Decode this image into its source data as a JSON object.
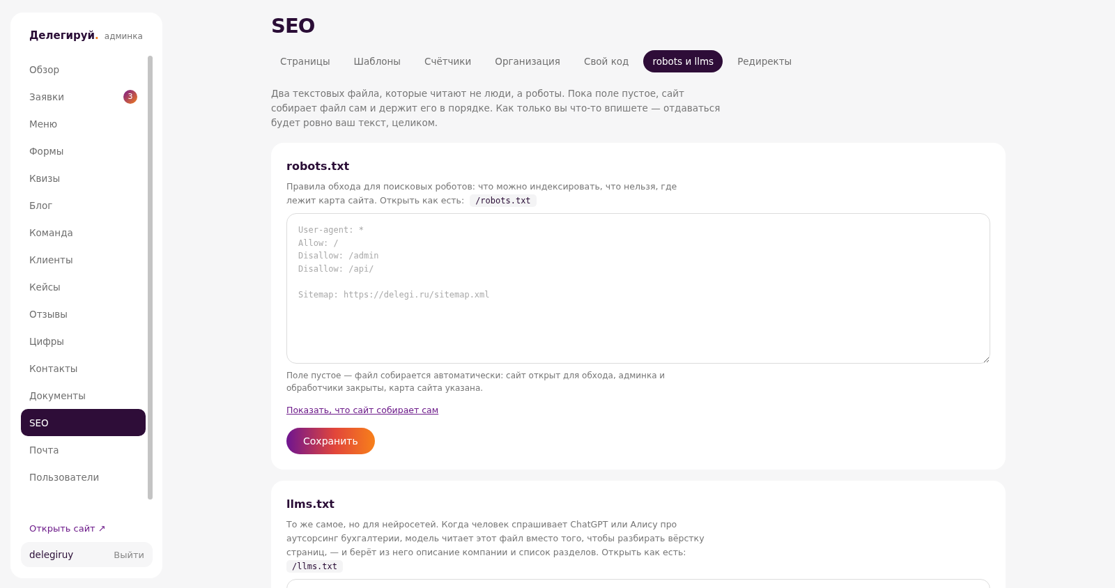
{
  "sidebar": {
    "brand": "Делегируй",
    "brand_dot": ".",
    "brand_sub": "админка",
    "items": [
      {
        "label": "Обзор",
        "selected": false
      },
      {
        "label": "Заявки",
        "selected": false,
        "badge": "3"
      },
      {
        "label": "Меню",
        "selected": false
      },
      {
        "label": "Формы",
        "selected": false
      },
      {
        "label": "Квизы",
        "selected": false
      },
      {
        "label": "Блог",
        "selected": false
      },
      {
        "label": "Команда",
        "selected": false
      },
      {
        "label": "Клиенты",
        "selected": false
      },
      {
        "label": "Кейсы",
        "selected": false
      },
      {
        "label": "Отзывы",
        "selected": false
      },
      {
        "label": "Цифры",
        "selected": false
      },
      {
        "label": "Контакты",
        "selected": false
      },
      {
        "label": "Документы",
        "selected": false
      },
      {
        "label": "SEO",
        "selected": true
      },
      {
        "label": "Почта",
        "selected": false
      },
      {
        "label": "Пользователи",
        "selected": false
      }
    ],
    "open_site": "Открыть сайт ↗",
    "user": "delegiruy",
    "logout": "Выйти"
  },
  "page": {
    "title": "SEO",
    "tabs": [
      {
        "label": "Страницы",
        "selected": false
      },
      {
        "label": "Шаблоны",
        "selected": false
      },
      {
        "label": "Счётчики",
        "selected": false
      },
      {
        "label": "Организация",
        "selected": false
      },
      {
        "label": "Свой код",
        "selected": false
      },
      {
        "label": "robots и llms",
        "selected": true
      },
      {
        "label": "Редиректы",
        "selected": false
      }
    ],
    "intro": "Два текстовых файла, которые читают не люди, а роботы. Пока поле пустое, сайт собирает файл сам и держит его в порядке. Как только вы что-то впишете — отдаваться будет ровно ваш текст, целиком.",
    "sections": [
      {
        "title": "robots.txt",
        "description": "Правила обхода для поисковых роботов: что можно индексировать, что нельзя, где лежит карта сайта. Открыть как есть:",
        "path": "/robots.txt",
        "placeholder": "User-agent: *\nAllow: /\nDisallow: /admin\nDisallow: /api/\n\nSitemap: https://delegi.ru/sitemap.xml",
        "hint": "Поле пустое — файл собирается автоматически: сайт открыт для обхода, админка и обработчики закрыты, карта сайта указана.",
        "link": "Показать, что сайт собирает сам",
        "button": "Сохранить"
      },
      {
        "title": "llms.txt",
        "description": "То же самое, но для нейросетей. Когда человек спрашивает ChatGPT или Алису про аутсорсинг бухгалтерии, модель читает этот файл вместо того, чтобы разбирать вёрстку страниц, — и берёт из него описание компании и список разделов. Открыть как есть:",
        "path": "/llms.txt"
      }
    ]
  }
}
